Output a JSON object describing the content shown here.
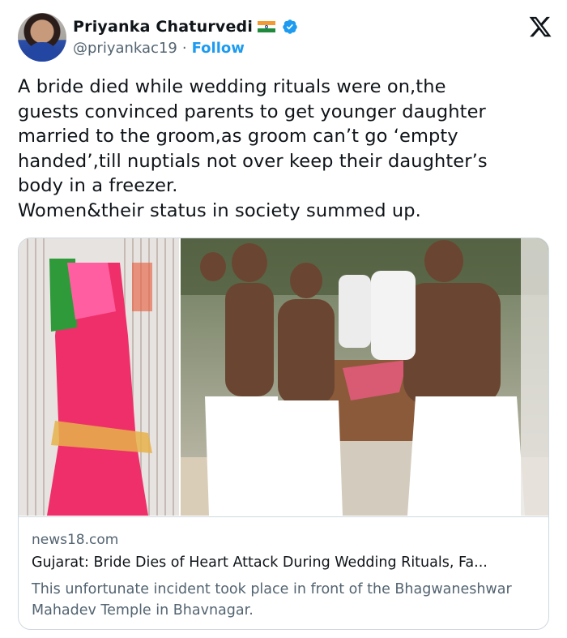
{
  "author": {
    "name": "Priyanka Chaturvedi",
    "handle": "@priyankac19",
    "separator": "·",
    "follow_label": "Follow"
  },
  "icons": {
    "flag": "india-flag-icon",
    "verified": "verified-badge-icon",
    "platform": "x-logo-icon"
  },
  "colors": {
    "accent": "#1d9bf0",
    "text": "#0f1419",
    "muted": "#536471",
    "border": "#cfd9de"
  },
  "tweet": {
    "text": "A bride died while wedding rituals were on,the\nguests convinced parents to get younger daughter\nmarried to the groom,as groom can’t go ‘empty\nhanded’,till nuptials not over keep their daughter’s\nbody in a freezer.\nWomen&their status in society summed up."
  },
  "link_card": {
    "domain": "news18.com",
    "title": "Gujarat: Bride Dies of Heart Attack During Wedding Rituals, Fa...",
    "description": "This unfortunate incident took place in front of the Bhagwaneshwar Mahadev Temple in Bhavnagar."
  }
}
